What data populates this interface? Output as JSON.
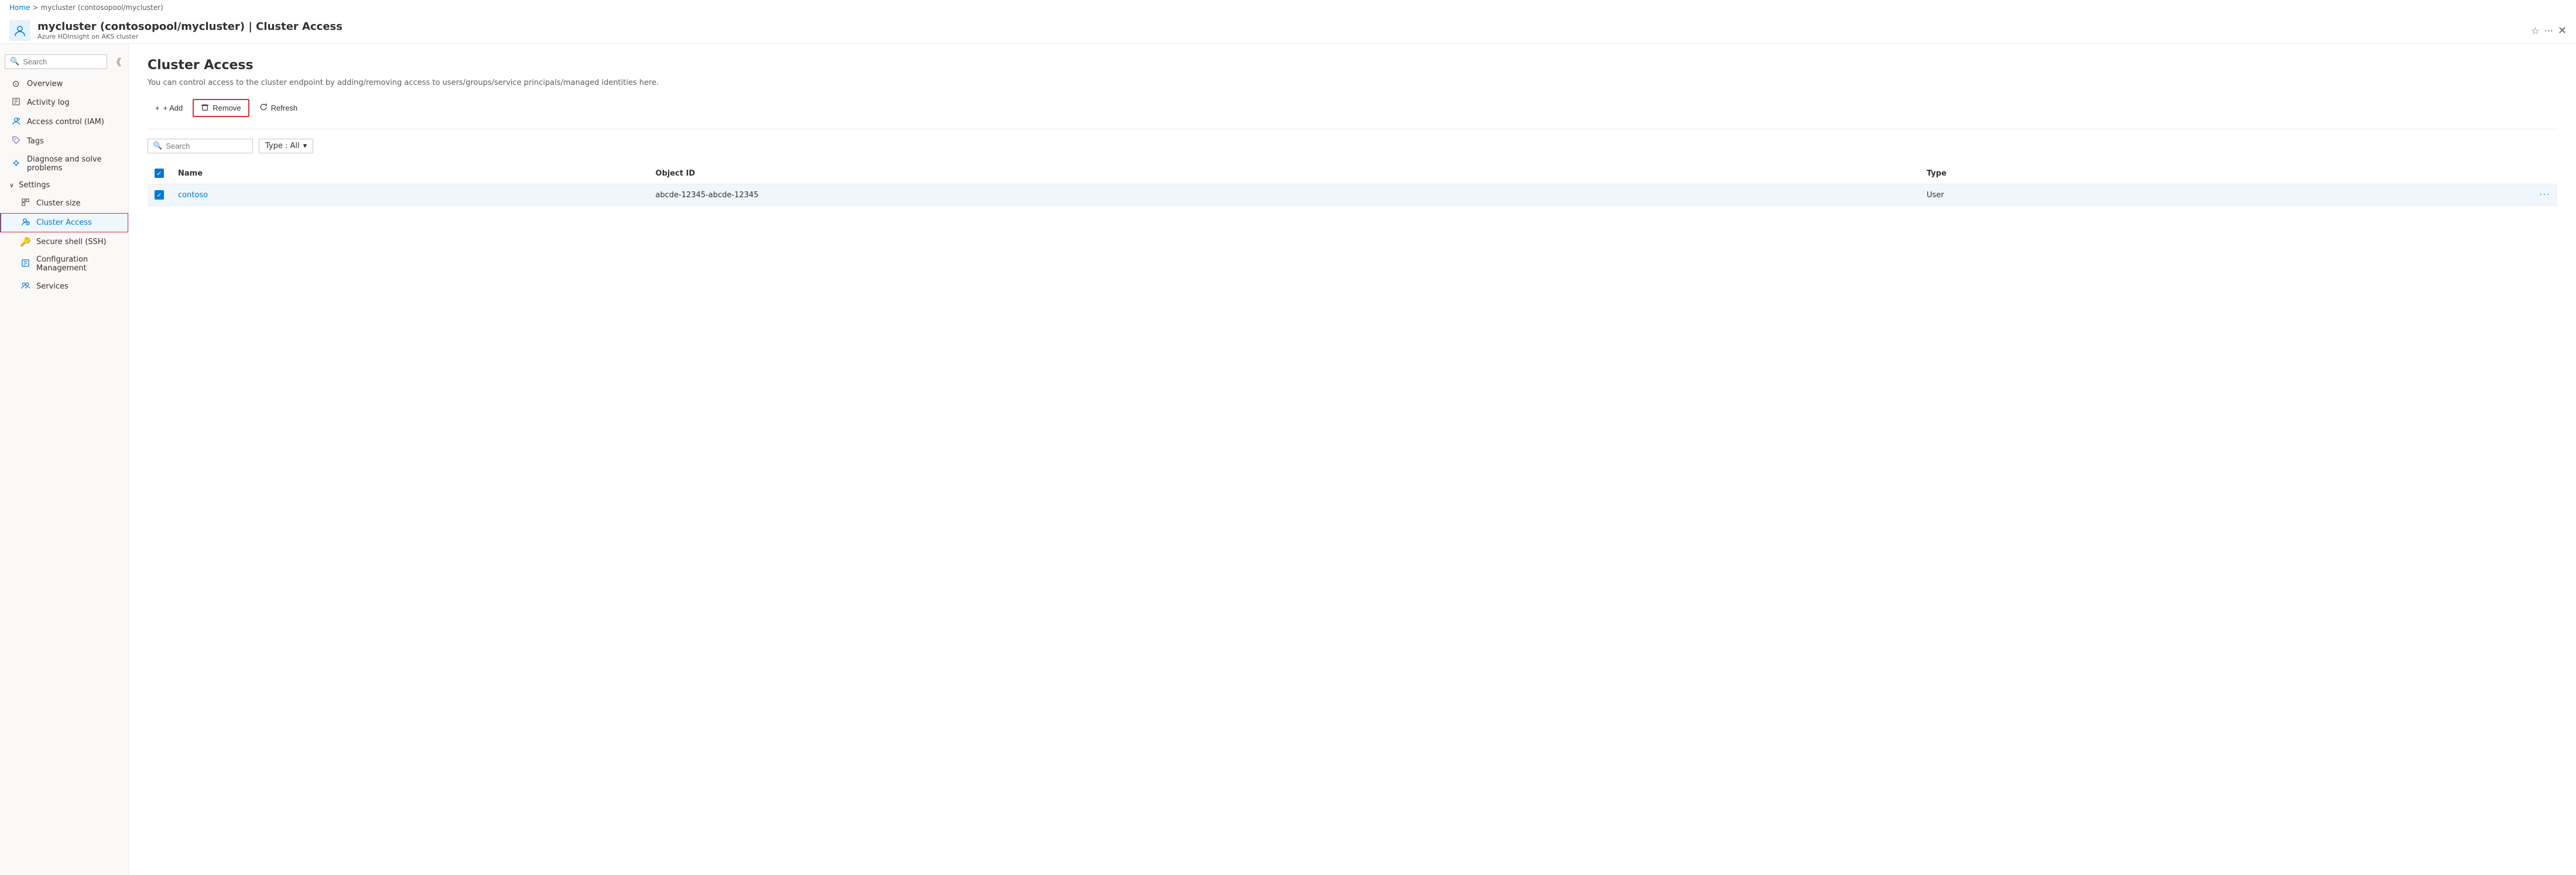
{
  "breadcrumb": {
    "home": "Home",
    "separator": ">",
    "current": "mycluster (contosopool/mycluster)"
  },
  "header": {
    "title": "mycluster (contosopool/mycluster) | Cluster Access",
    "subtitle": "Azure HDInsight on AKS cluster",
    "star_icon": "☆",
    "ellipsis_icon": "···",
    "close_icon": "✕"
  },
  "sidebar": {
    "search_placeholder": "Search",
    "items": [
      {
        "id": "overview",
        "label": "Overview",
        "icon": "⊙"
      },
      {
        "id": "activity-log",
        "label": "Activity log",
        "icon": "▦"
      },
      {
        "id": "access-control",
        "label": "Access control (IAM)",
        "icon": "👤"
      },
      {
        "id": "tags",
        "label": "Tags",
        "icon": "🏷"
      },
      {
        "id": "diagnose",
        "label": "Diagnose and solve problems",
        "icon": "🔧"
      }
    ],
    "settings_section": "Settings",
    "settings_items": [
      {
        "id": "cluster-size",
        "label": "Cluster size",
        "icon": "⊞"
      },
      {
        "id": "cluster-access",
        "label": "Cluster Access",
        "icon": "👤",
        "active": true
      },
      {
        "id": "secure-shell",
        "label": "Secure shell (SSH)",
        "icon": "🔑"
      },
      {
        "id": "config-mgmt",
        "label": "Configuration Management",
        "icon": "▦"
      },
      {
        "id": "services",
        "label": "Services",
        "icon": "👥"
      }
    ]
  },
  "content": {
    "title": "Cluster Access",
    "description": "You can control access to the cluster endpoint by adding/removing access to users/groups/service principals/managed identities here.",
    "toolbar": {
      "add_label": "+ Add",
      "remove_label": "Remove",
      "refresh_label": "Refresh"
    },
    "filter": {
      "search_placeholder": "Search",
      "type_label": "Type : All"
    },
    "table": {
      "columns": [
        "Name",
        "Object ID",
        "Type"
      ],
      "rows": [
        {
          "id": "row-1",
          "name": "contoso",
          "object_id": "abcde-12345-abcde-12345",
          "type": "User",
          "selected": true
        }
      ]
    }
  }
}
